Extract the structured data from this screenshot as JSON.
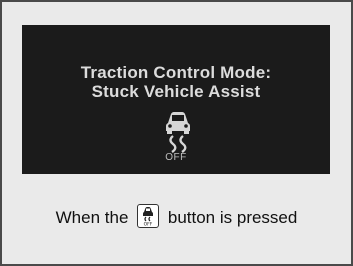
{
  "display": {
    "line1": "Traction Control Mode:",
    "line2": "Stuck Vehicle Assist",
    "indicator_icon": "traction-control-off-icon",
    "indicator_label": "OFF"
  },
  "caption": {
    "before": "When the",
    "button_icon": "traction-control-off-button-icon",
    "after": "button is pressed"
  }
}
